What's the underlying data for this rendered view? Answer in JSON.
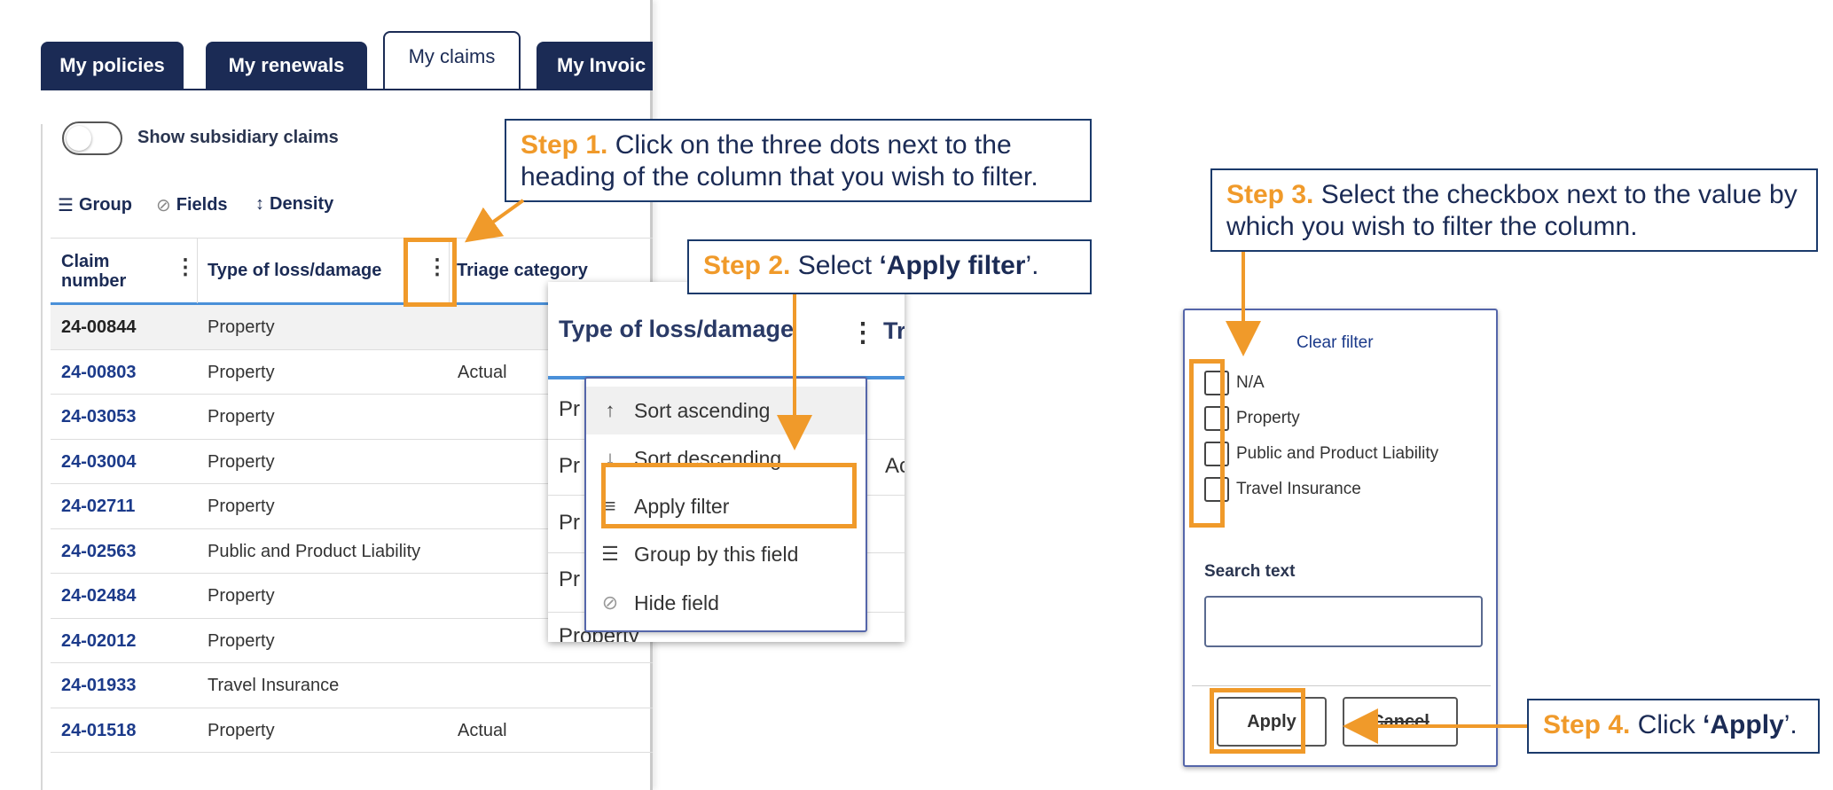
{
  "tabs": [
    {
      "label": "My policies"
    },
    {
      "label": "My renewals"
    },
    {
      "label": "My claims"
    },
    {
      "label": "My Invoic"
    }
  ],
  "toggle_label": "Show subsidiary claims",
  "toolbar": {
    "group": "Group",
    "fields": "Fields",
    "density": "Density"
  },
  "grid": {
    "columns": [
      "Claim number",
      "Type of loss/damage",
      "Triage category"
    ],
    "column_claim_line1": "Claim",
    "column_claim_line2": "number",
    "rows": [
      {
        "num": "24-00844",
        "type": "Property",
        "triage": ""
      },
      {
        "num": "24-00803",
        "type": "Property",
        "triage": "Actual"
      },
      {
        "num": "24-03053",
        "type": "Property",
        "triage": ""
      },
      {
        "num": "24-03004",
        "type": "Property",
        "triage": ""
      },
      {
        "num": "24-02711",
        "type": "Property",
        "triage": ""
      },
      {
        "num": "24-02563",
        "type": "Public and Product Liability",
        "triage": ""
      },
      {
        "num": "24-02484",
        "type": "Property",
        "triage": ""
      },
      {
        "num": "24-02012",
        "type": "Property",
        "triage": ""
      },
      {
        "num": "24-01933",
        "type": "Travel Insurance",
        "triage": ""
      },
      {
        "num": "24-01518",
        "type": "Property",
        "triage": "Actual"
      }
    ]
  },
  "column_menu": {
    "header": "Type of loss/damage",
    "header_next": "Tr",
    "bg_cells": [
      "Pr",
      "Pr",
      "Pr",
      "Pr",
      "Property"
    ],
    "bg_triage": "Ac",
    "items": [
      {
        "label": "Sort ascending",
        "icon": "arrow-up-icon"
      },
      {
        "label": "Sort descending",
        "icon": "arrow-down-icon"
      },
      {
        "label": "Apply filter",
        "icon": "filter-icon"
      },
      {
        "label": "Group by this field",
        "icon": "group-icon"
      },
      {
        "label": "Hide field",
        "icon": "eye-off-icon"
      }
    ]
  },
  "filter_panel": {
    "clear_filter": "Clear filter",
    "options": [
      "N/A",
      "Property",
      "Public and Product Liability",
      "Travel Insurance"
    ],
    "search_label": "Search text",
    "search_value": "",
    "apply": "Apply",
    "cancel": "Cancel"
  },
  "callouts": {
    "step1_label": "Step 1.",
    "step1_text": " Click on the three dots next to the heading of the column that you wish to filter.",
    "step2_label": "Step 2.",
    "step2_text": " Select ",
    "step2_bold": "‘Apply filter",
    "step2_end": "’.",
    "step3_label": "Step 3.",
    "step3_text": " Select the checkbox next to the value by which you wish to filter the column.",
    "step4_label": "Step 4.",
    "step4_text": " Click ",
    "step4_bold": "‘Apply",
    "step4_end": "’."
  },
  "colors": {
    "navy": "#1b2b55",
    "orange": "#f09a2a",
    "link": "#1b3a8a",
    "accent_line": "#4a90d9"
  }
}
